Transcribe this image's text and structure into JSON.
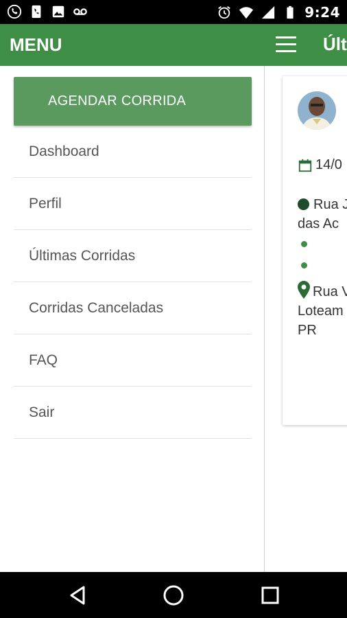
{
  "status_bar": {
    "time": "9:24",
    "left_icons": [
      "whatsapp-icon",
      "phone-icon",
      "image-icon",
      "voicemail-icon"
    ],
    "right_icons": [
      "alarm-icon",
      "wifi-icon",
      "signal-icon",
      "battery-icon"
    ]
  },
  "drawer": {
    "title": "MENU",
    "cta_label": "AGENDAR CORRIDA",
    "items": [
      {
        "label": "Dashboard"
      },
      {
        "label": "Perfil"
      },
      {
        "label": "Últimas Corridas"
      },
      {
        "label": "Corridas Canceladas"
      },
      {
        "label": "FAQ"
      },
      {
        "label": "Sair"
      }
    ]
  },
  "app": {
    "title": "Últ",
    "card": {
      "date": "14/0",
      "origin_line1": "Rua J",
      "origin_line2": "das Ac",
      "dest_line1": "Rua V",
      "dest_line2": "Loteam",
      "dest_line3": "PR"
    }
  },
  "colors": {
    "primary": "#3e8f45",
    "cta": "#5b9a5e",
    "origin_dot": "#1e4d2b"
  },
  "nav_bar": {
    "buttons": [
      "back-icon",
      "home-icon",
      "recents-icon"
    ]
  }
}
